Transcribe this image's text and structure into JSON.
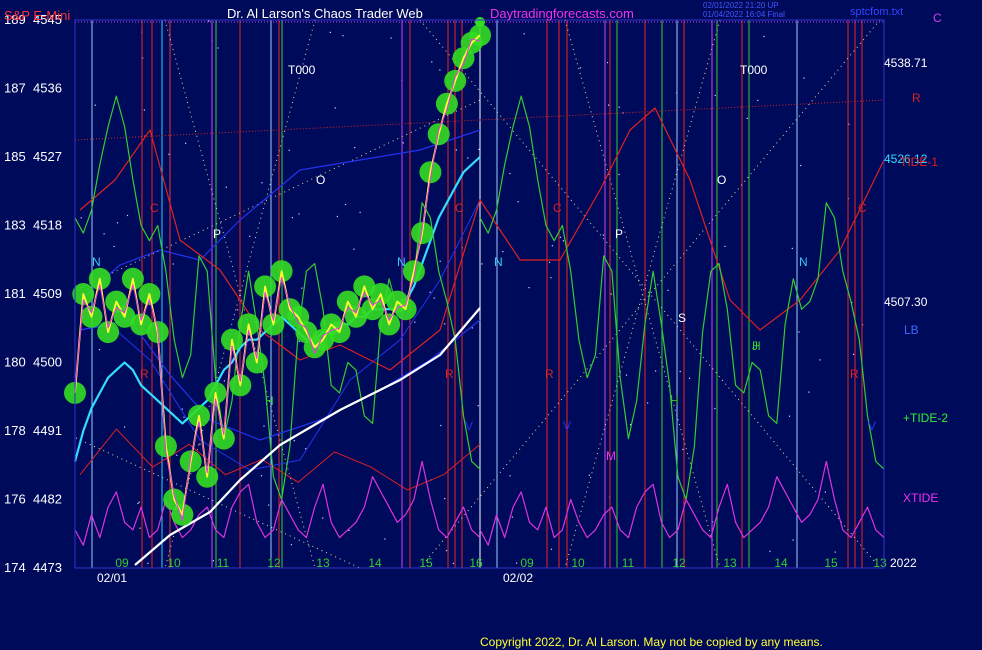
{
  "header": {
    "symbol": "S&P E-Mini",
    "title": "Dr. Al Larson's Chaos Trader Web",
    "site": "Daytradingforecasts.com",
    "file": "sptcfom.txt",
    "stamp1": "02/01/2022 21:20 UP",
    "stamp2": "01/04/2022 16:04 Final"
  },
  "footer": {
    "copyright": "Copyright 2022, Dr. Al Larson. May not be copied by any means."
  },
  "colors": {
    "background": "#000a5a",
    "price": "#ffff33",
    "price_glow": "#33dd22",
    "tide1": "#33ddff",
    "tide2": "#33cc33",
    "xtide": "#dd33dd",
    "trend": "#ffffff",
    "red_line": "#dd2222",
    "blue_line": "#2233ee"
  },
  "chart_data": {
    "type": "line",
    "title": "S&P E-Mini",
    "y_left_ticks": [
      {
        "idx": "189",
        "price": "4545"
      },
      {
        "idx": "187",
        "price": "4536"
      },
      {
        "idx": "185",
        "price": "4527"
      },
      {
        "idx": "183",
        "price": "4518"
      },
      {
        "idx": "181",
        "price": "4509"
      },
      {
        "idx": "180",
        "price": "4500"
      },
      {
        "idx": "178",
        "price": "4491"
      },
      {
        "idx": "176",
        "price": "4482"
      },
      {
        "idx": "174",
        "price": "4473"
      }
    ],
    "ylim": [
      4473,
      4545
    ],
    "x_hour_ticks": [
      "09",
      "10",
      "11",
      "12",
      "13",
      "14",
      "15",
      "16",
      "09",
      "10",
      "11",
      "12",
      "13",
      "14",
      "15",
      "13"
    ],
    "x_dates": [
      "02/01",
      "02/02"
    ],
    "year": "2022",
    "right_values": [
      {
        "label": "4538.71",
        "value": 4538.71
      },
      {
        "label": "4526.12",
        "value": 4526.12
      },
      {
        "label": "4507.30",
        "value": 4507.3
      }
    ],
    "right_labels": [
      "C",
      "R",
      "TIDE-1",
      "LB",
      "+TIDE-2",
      "XTIDE"
    ],
    "annotations": [
      "T000",
      "T000",
      "N",
      "N",
      "N",
      "N",
      "C",
      "C",
      "C",
      "C",
      "P",
      "P",
      "O",
      "O",
      "R",
      "R",
      "R",
      "R",
      "H",
      "H",
      "H",
      "V",
      "V",
      "V",
      "S",
      "M",
      "J"
    ],
    "series": [
      {
        "name": "Price",
        "values": [
          4496,
          4509,
          4506,
          4511,
          4504,
          4508,
          4506,
          4511,
          4505,
          4509,
          4504,
          4489,
          4482,
          4480,
          4487,
          4493,
          4485,
          4496,
          4490,
          4503,
          4497,
          4505,
          4500,
          4510,
          4505,
          4512,
          4507,
          4506,
          4504,
          4502,
          4503,
          4505,
          4504,
          4508,
          4506,
          4510,
          4507,
          4509,
          4505,
          4508,
          4507,
          4512,
          4517,
          4525,
          4530,
          4534,
          4537,
          4540,
          4542,
          4543
        ]
      },
      {
        "name": "TIDE-1",
        "values": [
          4487,
          4491,
          4494,
          4496,
          4498,
          4499,
          4500,
          4499,
          4497,
          4496,
          4495,
          4494,
          4493,
          4492,
          4493,
          4494,
          4495,
          4497,
          4499,
          4500,
          4502,
          4503,
          4503,
          4504,
          4505,
          4506,
          4505,
          4504,
          4503,
          4503,
          4504,
          4504,
          4505,
          4505,
          4506,
          4506,
          4507,
          4507,
          4507,
          4507,
          4508,
          4510,
          4513,
          4516,
          4519,
          4521,
          4523,
          4525,
          4526,
          4527
        ]
      },
      {
        "name": "TIDE-2",
        "values": [
          4519,
          4517,
          4520,
          4526,
          4531,
          4535,
          4531,
          4524,
          4518,
          4516,
          4518,
          4512,
          4503,
          4498,
          4501,
          4514,
          4512,
          4498,
          4490,
          4495,
          4505,
          4512,
          4505,
          4497,
          4485,
          4482,
          4489,
          4504,
          4512,
          4513,
          4507,
          4497,
          4496,
          4500,
          4499,
          4493,
          4492,
          4505,
          4511,
          4507,
          4508,
          4511,
          4521,
          4519,
          4512,
          4508,
          4503,
          4493,
          4487,
          4486
        ]
      },
      {
        "name": "XTIDE",
        "values": [
          4478,
          4476,
          4480,
          4477,
          4481,
          4483,
          4479,
          4478,
          4481,
          4477,
          4478,
          4482,
          4479,
          4477,
          4478,
          4480,
          4481,
          4478,
          4477,
          4481,
          4483,
          4484,
          4479,
          4477,
          4478,
          4482,
          4480,
          4478,
          4477,
          4481,
          4484,
          4479,
          4477,
          4478,
          4479,
          4481,
          4485,
          4483,
          4481,
          4479,
          4480,
          4482,
          4487,
          4482,
          4478,
          4477,
          4479,
          4481,
          4478,
          4477
        ]
      }
    ]
  }
}
